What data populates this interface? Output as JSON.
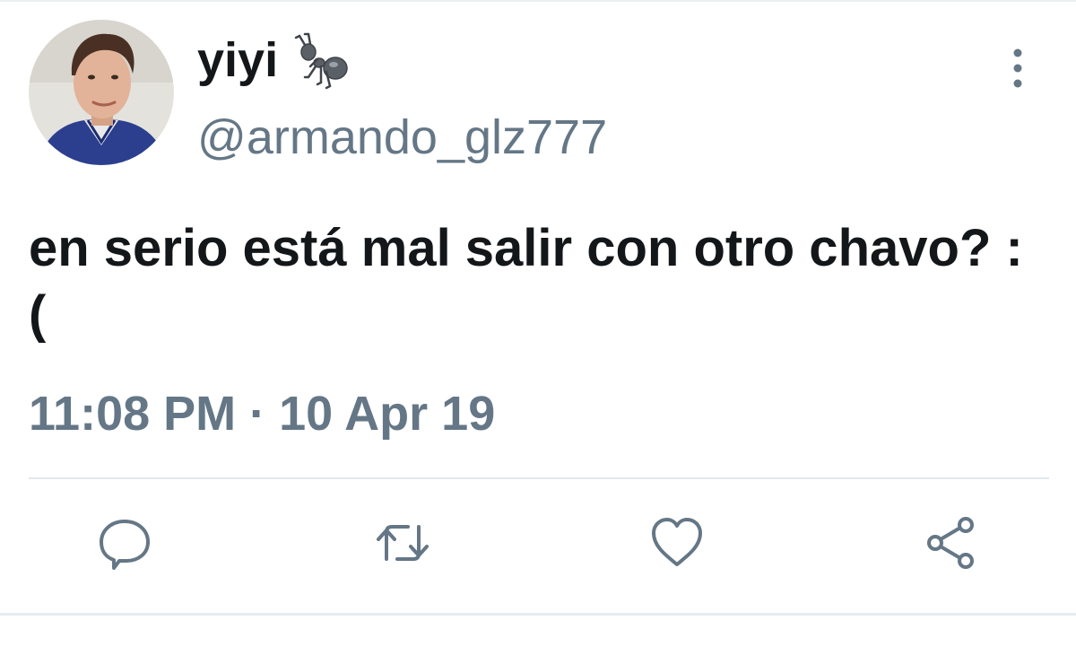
{
  "user": {
    "display_name": "yiyi",
    "name_emoji": "ant-emoji",
    "handle": "@armando_glz777"
  },
  "tweet": {
    "text": "en serio está mal salir con otro chavo? :(",
    "timestamp": "11:08 PM · 10 Apr 19"
  },
  "actions": {
    "icons": [
      "reply-icon",
      "retweet-icon",
      "like-icon",
      "share-icon"
    ]
  },
  "colors": {
    "text_primary": "#14171a",
    "text_secondary": "#657786",
    "icon": "#657786",
    "divider": "#e1e8ed"
  }
}
